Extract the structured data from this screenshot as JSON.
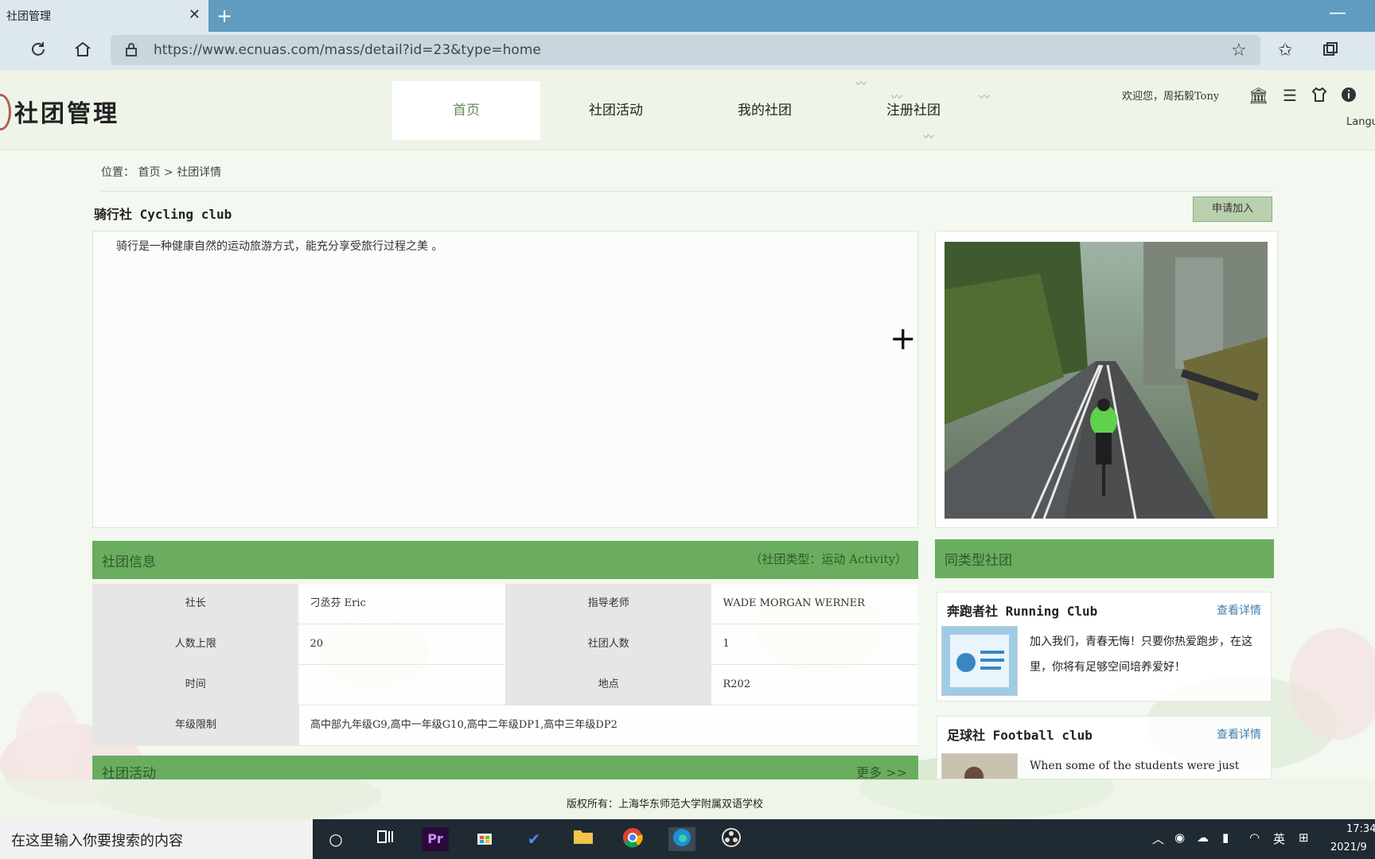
{
  "browser": {
    "tab_title": "社团管理",
    "tab_close": "✕",
    "new_tab": "+",
    "minimize": "—",
    "url": "https://www.ecnuas.com/mass/detail?id=23&type=home"
  },
  "site": {
    "title": "社团管理",
    "nav": [
      "首页",
      "社团活动",
      "我的社团",
      "注册社团"
    ],
    "welcome": "欢迎您，周拓毅Tony",
    "language_label": "Langu"
  },
  "breadcrumb": "位置：  首页 > 社团详情",
  "club": {
    "title": "骑行社 Cycling club",
    "apply_label": "申请加入",
    "description": "骑行是一种健康自然的运动旅游方式，能充分享受旅行过程之美 。"
  },
  "info": {
    "header": "社团信息",
    "type_label": "（社团类型：运动 Activity）",
    "rows": [
      {
        "l1": "社长",
        "v1": "刁丞芬 Eric",
        "l2": "指导老师",
        "v2": "WADE MORGAN WERNER"
      },
      {
        "l1": "人数上限",
        "v1": "20",
        "l2": "社团人数",
        "v2": "1"
      },
      {
        "l1": "时间",
        "v1": "",
        "l2": "地点",
        "v2": "R202"
      }
    ],
    "grade_label": "年级限制",
    "grade_value": "高中部九年级G9,高中一年级G10,高中二年级DP1,高中三年级DP2"
  },
  "activities": {
    "header": "社团活动",
    "more": "更多 >>"
  },
  "similar": {
    "header": "同类型社团",
    "items": [
      {
        "title": "奔跑者社 Running Club",
        "more": "查看详情",
        "desc": "加入我们，青春无悔！只要你热爱跑步，在这里，你将有足够空间培养爱好！"
      },
      {
        "title": "足球社 Football club",
        "more": "查看详情",
        "desc": "When some of the students were just"
      }
    ]
  },
  "footer": {
    "copyright": "版权所有：上海华东师范大学附属双语学校"
  },
  "taskbar": {
    "search_placeholder": "在这里输入你要搜索的内容",
    "ime": "英",
    "clock_time": "17:34",
    "clock_date": "2021/9"
  },
  "colors": {
    "accent_green": "#6aad5e",
    "titlebar_blue": "#5f9cbf"
  }
}
